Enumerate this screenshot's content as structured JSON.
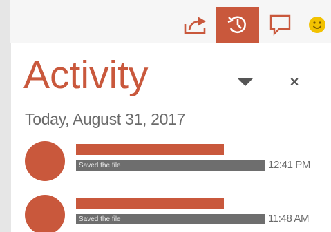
{
  "toolbar": {
    "share_icon": "share-icon",
    "activity_icon": "activity-history-icon",
    "comments_icon": "comment-icon",
    "feedback_icon": "smiley-icon",
    "active_color": "#c9583c",
    "smiley_color": "#f2c200"
  },
  "panel": {
    "title": "Activity",
    "dropdown_icon": "chevron-down-icon",
    "close_label": "×",
    "accent_color": "#c9583c"
  },
  "activity": {
    "date_header": "Today, August 31, 2017",
    "items": [
      {
        "description": "Saved the file",
        "time": "12:41 PM"
      },
      {
        "description": "Saved the file",
        "time": "11:48 AM"
      }
    ]
  }
}
